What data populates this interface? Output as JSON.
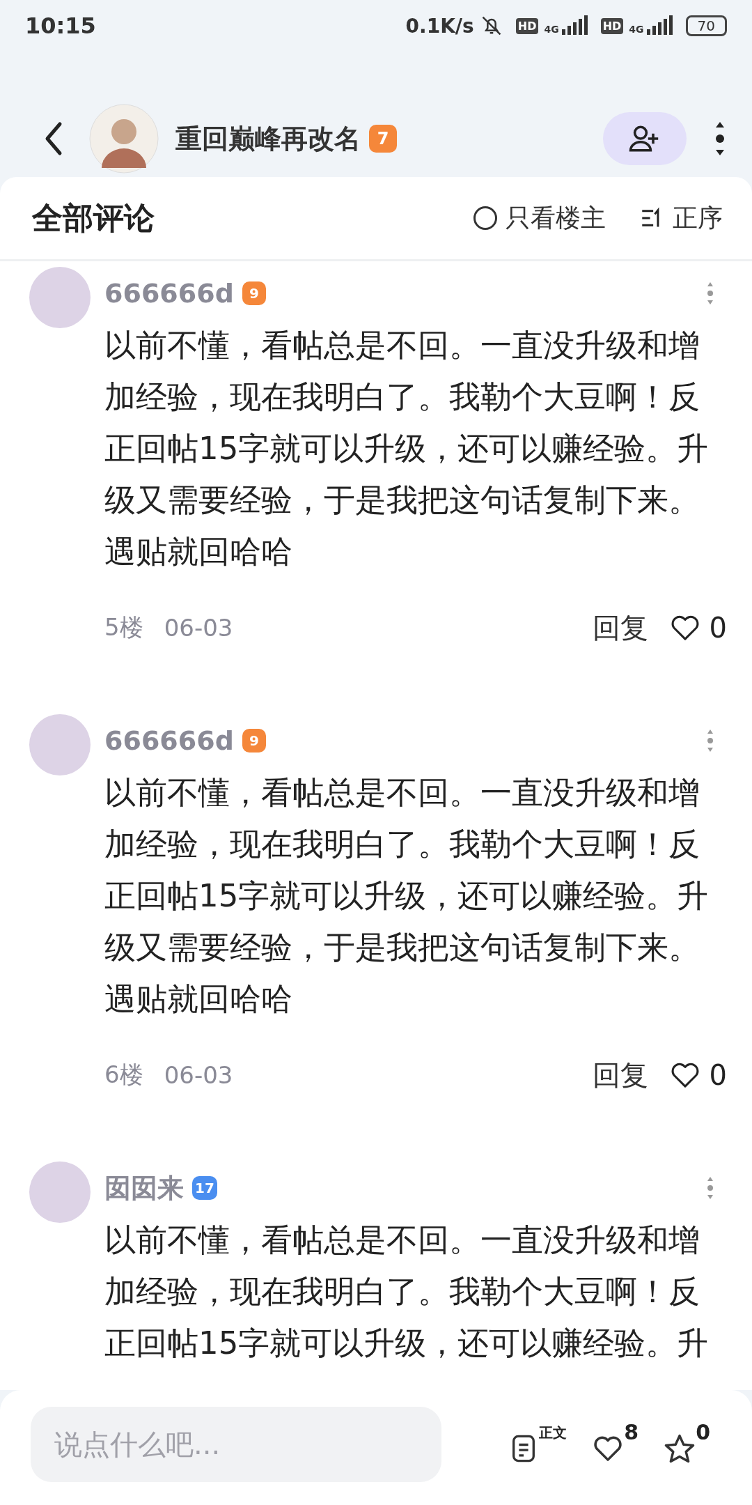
{
  "status_bar": {
    "time": "10:15",
    "speed": "0.1K/s",
    "sims": [
      {
        "hd": "HD",
        "net": "4G"
      },
      {
        "hd": "HD",
        "net": "4G"
      }
    ],
    "battery": "70"
  },
  "header": {
    "user": "重回巅峰再改名",
    "badge": {
      "level": "7",
      "color": "#f5873a"
    }
  },
  "comments_header": {
    "title": "全部评论",
    "only_op": {
      "label": "只看楼主",
      "checked": false
    },
    "sort": {
      "label": "正序"
    }
  },
  "comments": [
    {
      "user": "666666d",
      "badge": {
        "level": "9",
        "color": "#f5873a"
      },
      "text": "以前不懂，看帖总是不回。一直没升级和增加经验，现在我明白了。我勒个大豆啊！反正回帖15字就可以升级，还可以赚经验。升级又需要经验，于是我把这句话复制下来。遇贴就回哈哈",
      "floor": "5楼",
      "date": "06-03",
      "reply": "回复",
      "likes": "0"
    },
    {
      "user": "666666d",
      "badge": {
        "level": "9",
        "color": "#f5873a"
      },
      "text": "以前不懂，看帖总是不回。一直没升级和增加经验，现在我明白了。我勒个大豆啊！反正回帖15字就可以升级，还可以赚经验。升级又需要经验，于是我把这句话复制下来。遇贴就回哈哈",
      "floor": "6楼",
      "date": "06-03",
      "reply": "回复",
      "likes": "0"
    },
    {
      "user": "囡囡来",
      "badge": {
        "level": "17",
        "color": "#4a8ef0"
      },
      "text": "以前不懂，看帖总是不回。一直没升级和增加经验，现在我明白了。我勒个大豆啊！反正回帖15字就可以升级，还可以赚经验。升"
    }
  ],
  "bottom_bar": {
    "placeholder": "说点什么吧...",
    "doc_label": "正文",
    "likes": "8",
    "stars": "0"
  }
}
